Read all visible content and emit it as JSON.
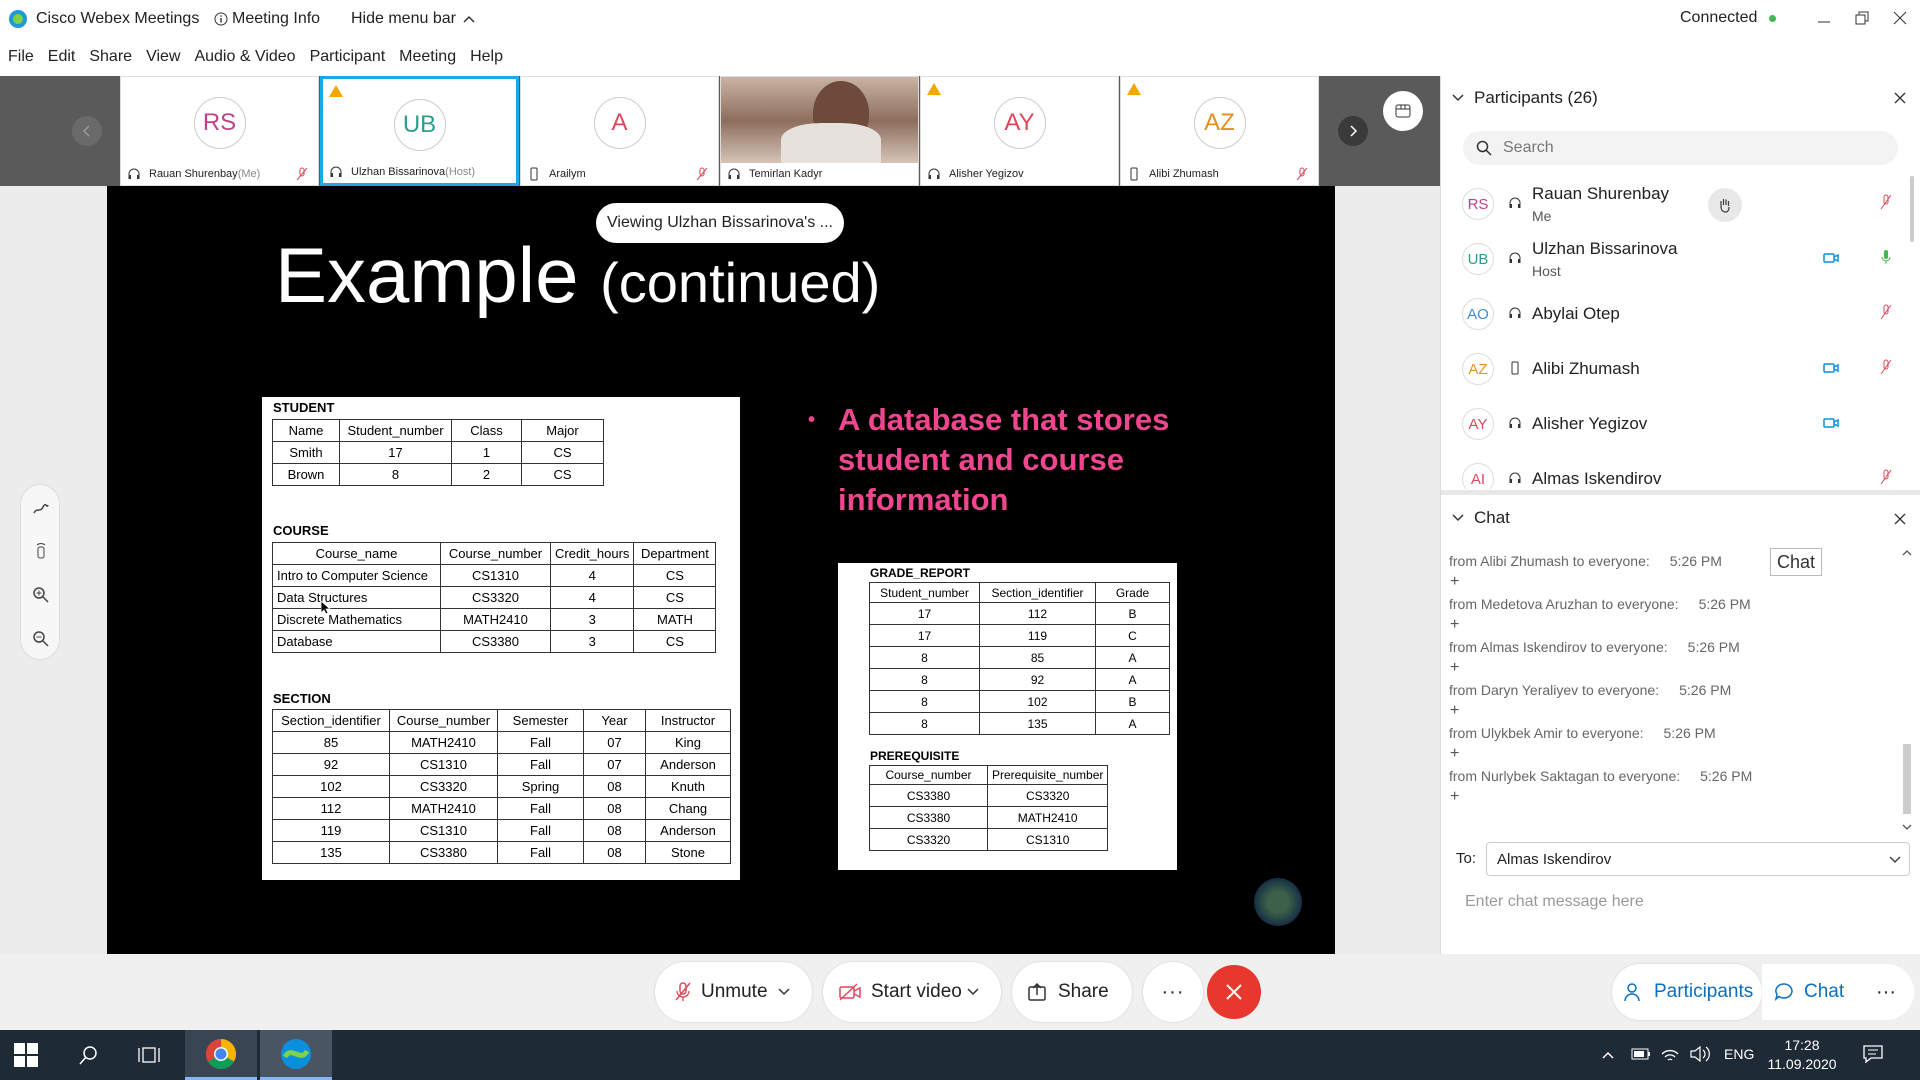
{
  "titlebar": {
    "app": "Cisco Webex Meetings",
    "meeting_info": "Meeting Info",
    "hide_menu": "Hide menu bar",
    "status": "Connected"
  },
  "menu": [
    "File",
    "Edit",
    "Share",
    "View",
    "Audio & Video",
    "Participant",
    "Meeting",
    "Help"
  ],
  "video_strip": [
    {
      "initials": "RS",
      "name": "Rauan Shurenbay",
      "tag": "(Me)",
      "color": "#c0428a"
    },
    {
      "initials": "UB",
      "name": "Ulzhan Bissarinova",
      "tag": "(Host)",
      "color": "#2d9d8f"
    },
    {
      "initials": "A",
      "name": "Arailym",
      "tag": "",
      "color": "#e0475a"
    },
    {
      "initials": "",
      "name": "Temirlan Kadyr",
      "tag": "",
      "color": "#000"
    },
    {
      "initials": "AY",
      "name": "Alisher Yegizov",
      "tag": "",
      "color": "#e0475a"
    },
    {
      "initials": "AZ",
      "name": "Alibi Zhumash",
      "tag": "",
      "color": "#e58f1c"
    }
  ],
  "viewing": "Viewing Ulzhan Bissarinova's ...",
  "slide": {
    "title_big": "Example",
    "title_small": "(continued)",
    "bullet": "A database that stores student and course information",
    "student": {
      "label": "STUDENT",
      "headers": [
        "Name",
        "Student_number",
        "Class",
        "Major"
      ],
      "rows": [
        [
          "Smith",
          "17",
          "1",
          "CS"
        ],
        [
          "Brown",
          "8",
          "2",
          "CS"
        ]
      ]
    },
    "course": {
      "label": "COURSE",
      "headers": [
        "Course_name",
        "Course_number",
        "Credit_hours",
        "Department"
      ],
      "rows": [
        [
          "Intro to Computer Science",
          "CS1310",
          "4",
          "CS"
        ],
        [
          "Data Structures",
          "CS3320",
          "4",
          "CS"
        ],
        [
          "Discrete Mathematics",
          "MATH2410",
          "3",
          "MATH"
        ],
        [
          "Database",
          "CS3380",
          "3",
          "CS"
        ]
      ]
    },
    "section": {
      "label": "SECTION",
      "headers": [
        "Section_identifier",
        "Course_number",
        "Semester",
        "Year",
        "Instructor"
      ],
      "rows": [
        [
          "85",
          "MATH2410",
          "Fall",
          "07",
          "King"
        ],
        [
          "92",
          "CS1310",
          "Fall",
          "07",
          "Anderson"
        ],
        [
          "102",
          "CS3320",
          "Spring",
          "08",
          "Knuth"
        ],
        [
          "112",
          "MATH2410",
          "Fall",
          "08",
          "Chang"
        ],
        [
          "119",
          "CS1310",
          "Fall",
          "08",
          "Anderson"
        ],
        [
          "135",
          "CS3380",
          "Fall",
          "08",
          "Stone"
        ]
      ]
    },
    "grade": {
      "label": "GRADE_REPORT",
      "headers": [
        "Student_number",
        "Section_identifier",
        "Grade"
      ],
      "rows": [
        [
          "17",
          "112",
          "B"
        ],
        [
          "17",
          "119",
          "C"
        ],
        [
          "8",
          "85",
          "A"
        ],
        [
          "8",
          "92",
          "A"
        ],
        [
          "8",
          "102",
          "B"
        ],
        [
          "8",
          "135",
          "A"
        ]
      ]
    },
    "prereq": {
      "label": "PREREQUISITE",
      "headers": [
        "Course_number",
        "Prerequisite_number"
      ],
      "rows": [
        [
          "CS3380",
          "CS3320"
        ],
        [
          "CS3380",
          "MATH2410"
        ],
        [
          "CS3320",
          "CS1310"
        ]
      ]
    }
  },
  "participants": {
    "title": "Participants (26)",
    "search_placeholder": "Search",
    "list": [
      {
        "initials": "RS",
        "name": "Rauan Shurenbay",
        "role": "Me",
        "color": "#c0428a"
      },
      {
        "initials": "UB",
        "name": "Ulzhan Bissarinova",
        "role": "Host",
        "color": "#2d9d8f"
      },
      {
        "initials": "AO",
        "name": "Abylai Otep",
        "role": "",
        "color": "#3a8fd6"
      },
      {
        "initials": "AZ",
        "name": "Alibi Zhumash",
        "role": "",
        "color": "#e58f1c"
      },
      {
        "initials": "AY",
        "name": "Alisher Yegizov",
        "role": "",
        "color": "#e0475a"
      },
      {
        "initials": "AI",
        "name": "Almas Iskendirov",
        "role": "",
        "color": "#e0475a"
      }
    ]
  },
  "chat": {
    "title": "Chat",
    "tooltip": "Chat",
    "messages": [
      {
        "from": "from Alibi Zhumash to everyone:",
        "time": "5:26 PM",
        "text": "+"
      },
      {
        "from": "from Medetova Aruzhan to everyone:",
        "time": "5:26 PM",
        "text": "+"
      },
      {
        "from": "from Almas Iskendirov to everyone:",
        "time": "5:26 PM",
        "text": "+"
      },
      {
        "from": "from Daryn Yeraliyev to everyone:",
        "time": "5:26 PM",
        "text": "+"
      },
      {
        "from": "from Ulykbek Amir to everyone:",
        "time": "5:26 PM",
        "text": "+"
      },
      {
        "from": "from Nurlybek Saktagan to everyone:",
        "time": "5:26 PM",
        "text": "+"
      }
    ],
    "to_label": "To:",
    "to_value": "Almas Iskendirov",
    "input_placeholder": "Enter chat message here"
  },
  "controls": {
    "unmute": "Unmute",
    "start_video": "Start video",
    "share": "Share",
    "more": "···",
    "participants": "Participants",
    "chat": "Chat"
  },
  "taskbar": {
    "lang": "ENG",
    "time": "17:28",
    "date": "11.09.2020"
  },
  "colors": {
    "accent": "#0a8fdc",
    "end": "#e8372c",
    "bullet": "#f0468f"
  }
}
